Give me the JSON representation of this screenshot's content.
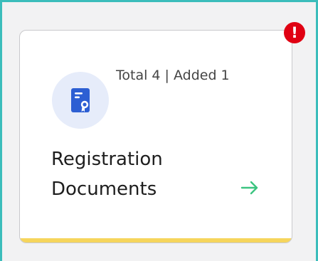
{
  "card": {
    "count_label": "Total 4 | Added 1",
    "title_line1": "Registration",
    "title_line2": "Documents",
    "icon": "certificate-document-icon",
    "alert_badge": "!",
    "action_icon": "arrow-right-icon"
  },
  "colors": {
    "frame_border": "#3bbdbb",
    "icon_bg": "#e6ecfa",
    "icon_fg": "#2d5fd3",
    "badge": "#e00012",
    "arrow": "#3cc480",
    "accent_bar": "#f6d55c"
  }
}
